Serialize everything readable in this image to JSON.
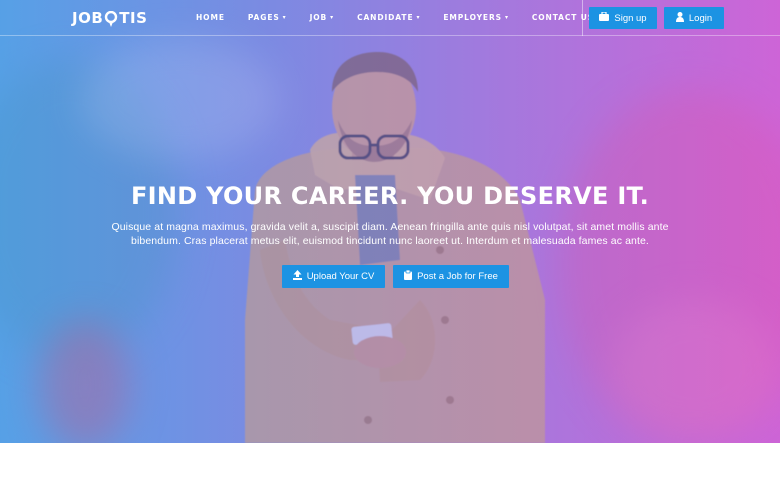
{
  "brand": {
    "logo_prefix": "JOB",
    "logo_suffix": "TIS"
  },
  "nav": {
    "items": [
      {
        "label": "HOME",
        "has_dropdown": false
      },
      {
        "label": "PAGES",
        "has_dropdown": true
      },
      {
        "label": "JOB",
        "has_dropdown": true
      },
      {
        "label": "CANDIDATE",
        "has_dropdown": true
      },
      {
        "label": "EMPLOYERS",
        "has_dropdown": true
      },
      {
        "label": "CONTACT US",
        "has_dropdown": false
      }
    ],
    "signup_label": "Sign up",
    "login_label": "Login",
    "signup_icon": "briefcase-icon",
    "login_icon": "user-icon"
  },
  "hero": {
    "headline": "FIND YOUR CAREER. YOU DESERVE IT.",
    "subtext": "Quisque at magna maximus, gravida velit a, suscipit diam. Aenean fringilla ante quis nisl volutpat, sit amet mollis ante bibendum. Cras placerat metus elit, euismod tincidunt nunc laoreet ut. Interdum et malesuada fames ac ante.",
    "upload_label": "Upload Your CV",
    "post_label": "Post a Job for Free",
    "upload_icon": "upload-icon",
    "post_icon": "clipboard-icon"
  },
  "colors": {
    "accent": "#1c93e3",
    "gradient_left": "#5aa6e6",
    "gradient_right": "#d06ad4"
  }
}
